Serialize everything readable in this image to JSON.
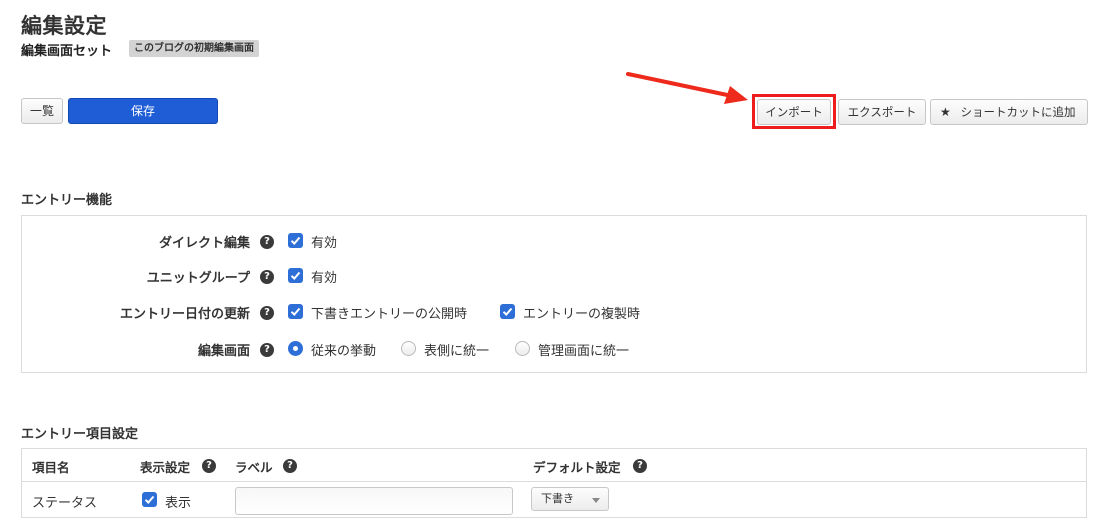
{
  "header": {
    "title": "編集設定",
    "subtitle": "編集画面セット",
    "badge": "このブログの初期編集画面"
  },
  "toolbar": {
    "list_label": "一覧",
    "save_label": "保存",
    "import_label": "インポート",
    "export_label": "エクスポート",
    "shortcut_label": "ショートカットに追加"
  },
  "entry_features": {
    "heading": "エントリー機能",
    "direct_edit": {
      "label": "ダイレクト編集",
      "option": "有効",
      "checked": true
    },
    "unit_group": {
      "label": "ユニットグループ",
      "option": "有効",
      "checked": true
    },
    "date_update": {
      "label": "エントリー日付の更新",
      "options": [
        {
          "label": "下書きエントリーの公開時",
          "checked": true
        },
        {
          "label": "エントリーの複製時",
          "checked": true
        }
      ]
    },
    "edit_screen": {
      "label": "編集画面",
      "options": [
        {
          "label": "従来の挙動",
          "selected": true
        },
        {
          "label": "表側に統一",
          "selected": false
        },
        {
          "label": "管理画面に統一",
          "selected": false
        }
      ]
    }
  },
  "entry_items": {
    "heading": "エントリー項目設定",
    "columns": [
      "項目名",
      "表示設定",
      "ラベル",
      "デフォルト設定"
    ],
    "rows": [
      {
        "name": "ステータス",
        "display": "表示",
        "label_value": "",
        "default": "下書き"
      }
    ]
  },
  "colors": {
    "primary": "#1f5dd6",
    "highlight": "#ee1c1c",
    "checkbox": "#2d6fd6"
  },
  "icons": {
    "help": "question-circle-icon",
    "star": "star-icon",
    "check": "check-icon",
    "arrow": "red-arrow-annotation"
  }
}
